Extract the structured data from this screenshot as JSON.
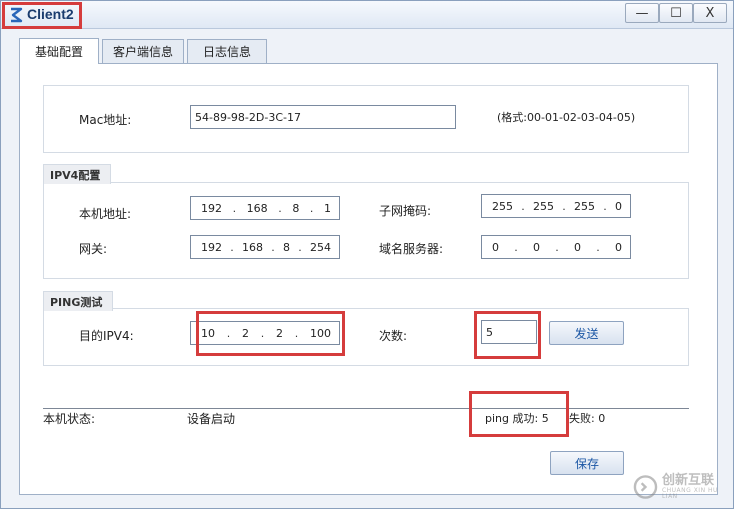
{
  "window": {
    "title": "Client2",
    "controls": {
      "minimize": "—",
      "maximize": "☐",
      "close": "X"
    }
  },
  "tabs": [
    {
      "label": "基础配置",
      "active": true
    },
    {
      "label": "客户端信息",
      "active": false
    },
    {
      "label": "日志信息",
      "active": false
    }
  ],
  "mac": {
    "label": "Mac地址:",
    "value": "54-89-98-2D-3C-17",
    "format_hint": "(格式:00-01-02-03-04-05)"
  },
  "ipv4": {
    "legend": "IPV4配置",
    "local_label": "本机地址:",
    "local_ip": [
      "192",
      "168",
      "8",
      "1"
    ],
    "mask_label": "子网掩码:",
    "mask": [
      "255",
      "255",
      "255",
      "0"
    ],
    "gateway_label": "网关:",
    "gateway": [
      "192",
      "168",
      "8",
      "254"
    ],
    "dns_label": "域名服务器:",
    "dns": [
      "0",
      "0",
      "0",
      "0"
    ]
  },
  "ping": {
    "legend": "PING测试",
    "dest_label": "目的IPV4:",
    "dest_ip": [
      "10",
      "2",
      "2",
      "100"
    ],
    "count_label": "次数:",
    "count": "5",
    "send_label": "发送"
  },
  "status": {
    "label": "本机状态:",
    "value": "设备启动",
    "success_text": "ping 成功: 5",
    "fail_text": "失败: 0"
  },
  "save_label": "保存",
  "watermark": {
    "name": "创新互联",
    "sub": "CHUANG XIN HU LIAN"
  },
  "colors": {
    "highlight": "#d53c3c",
    "title": "#1a3c6e",
    "button_text": "#1c57a5"
  }
}
